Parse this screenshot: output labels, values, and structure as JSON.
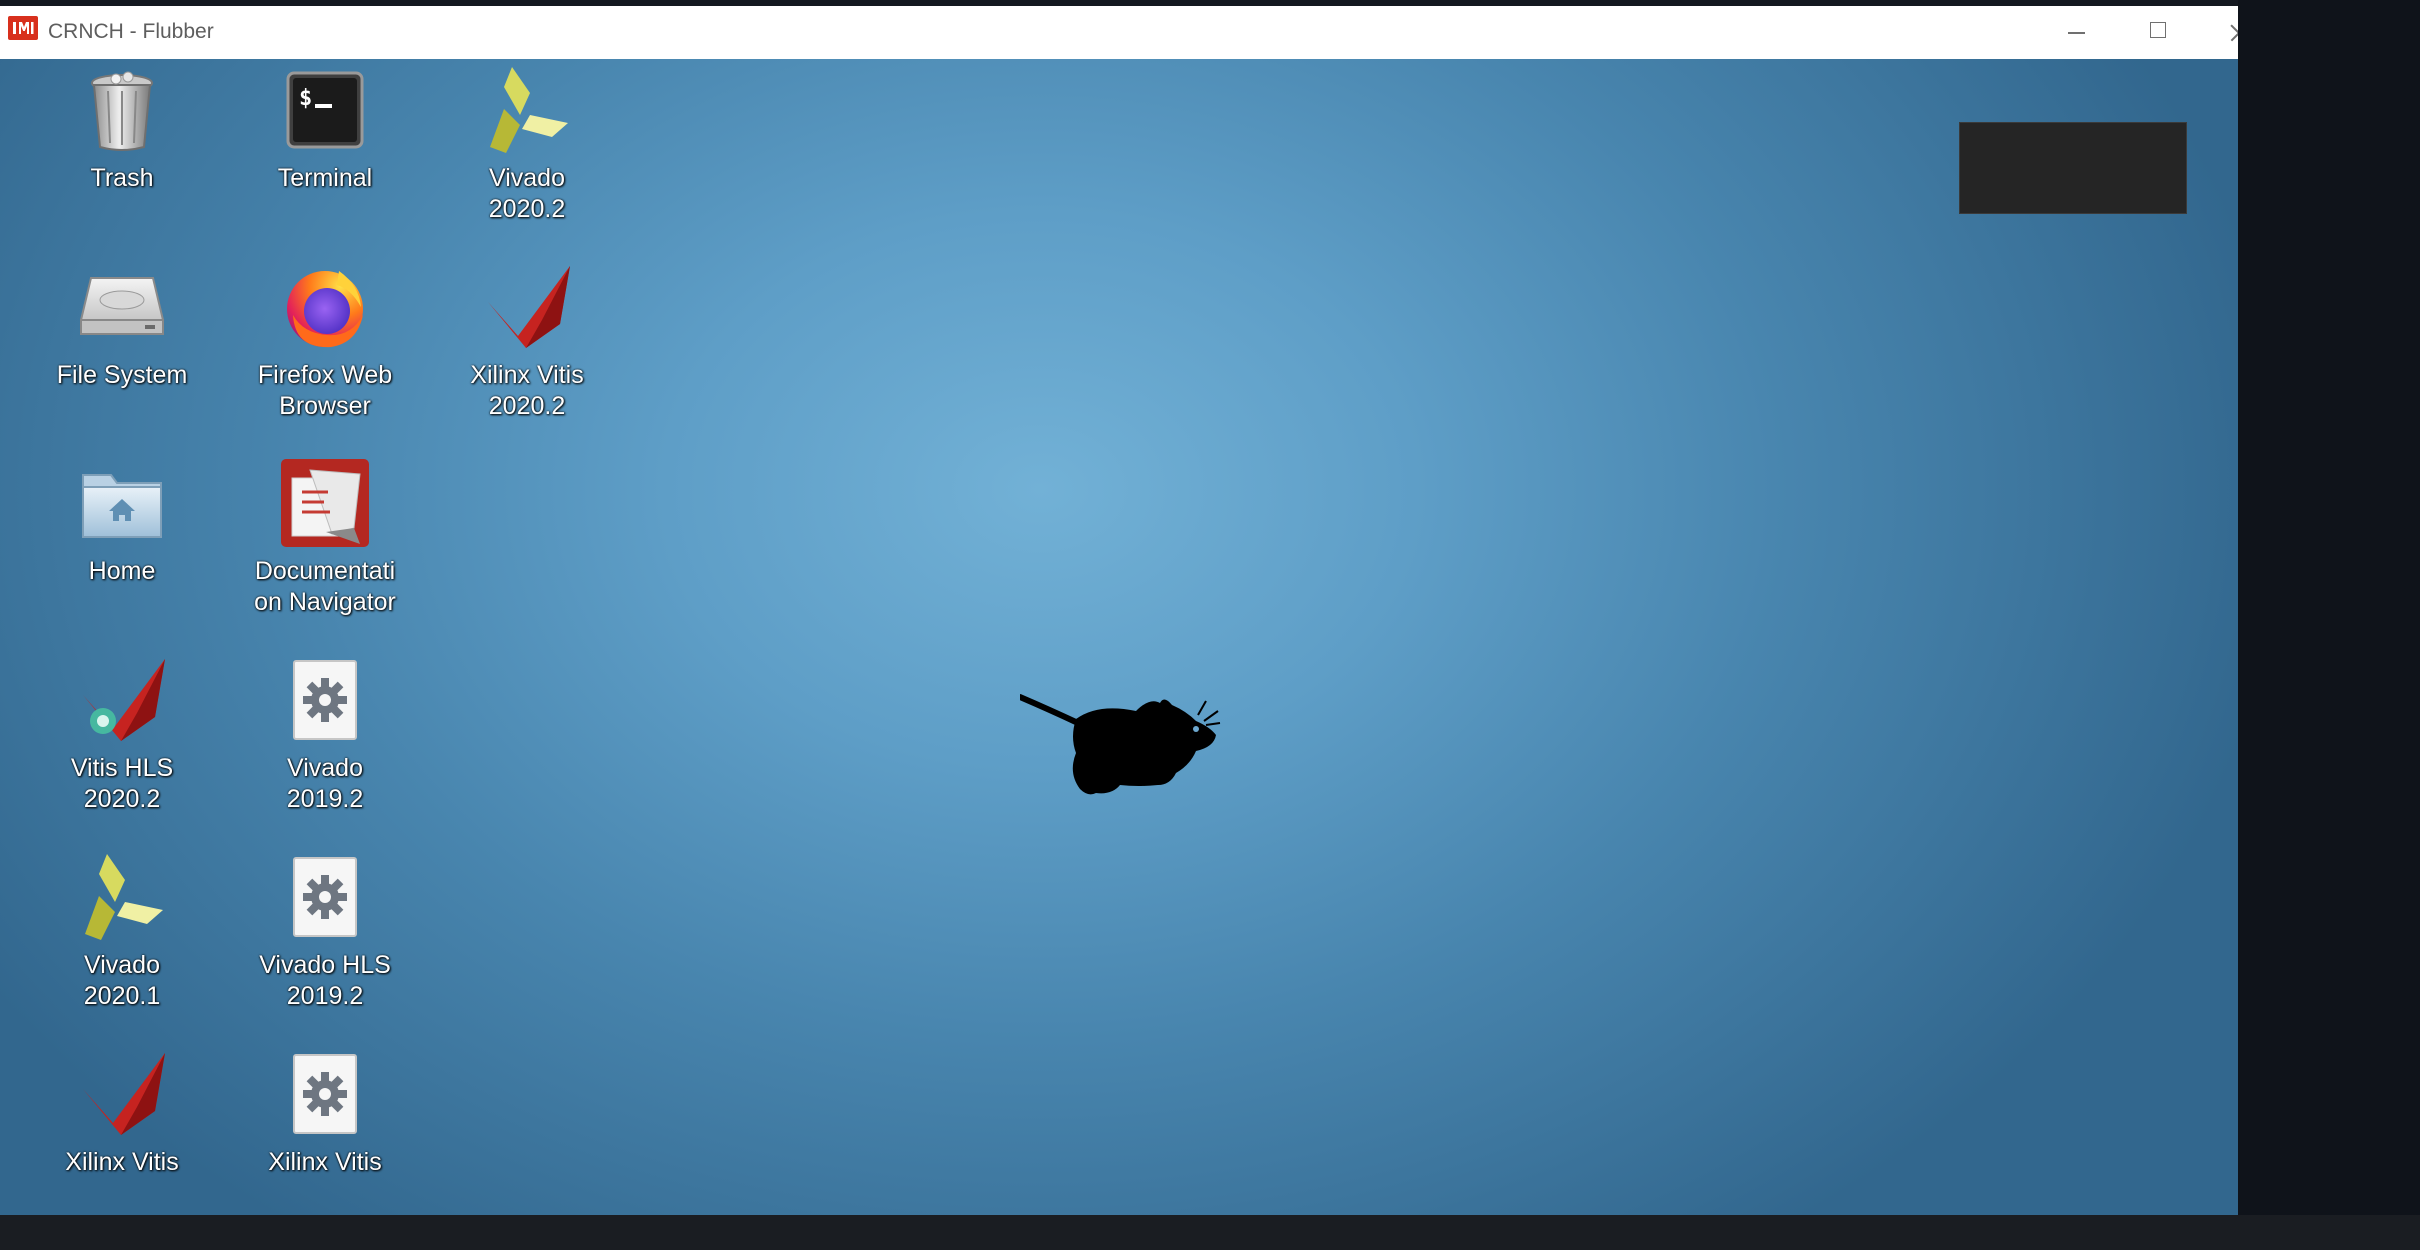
{
  "window": {
    "title": "CRNCH - Flubber",
    "app_icon": "iml-icon",
    "controls": [
      "minimize",
      "maximize",
      "close"
    ]
  },
  "desktop": {
    "background": "xfce-blue-gradient",
    "centerpiece": "xfce-mouse-logo",
    "icons": [
      {
        "id": "trash",
        "label": "Trash",
        "icon": "trash-icon"
      },
      {
        "id": "terminal",
        "label": "Terminal",
        "icon": "terminal-icon"
      },
      {
        "id": "vivado-2020-2",
        "label": "Vivado\n2020.2",
        "icon": "vivado-icon"
      },
      {
        "id": "file-system",
        "label": "File System",
        "icon": "drive-icon"
      },
      {
        "id": "firefox",
        "label": "Firefox Web\nBrowser",
        "icon": "firefox-icon"
      },
      {
        "id": "xilinx-vitis-2020-2",
        "label": "Xilinx Vitis\n2020.2",
        "icon": "vitis-icon"
      },
      {
        "id": "home",
        "label": "Home",
        "icon": "home-folder-icon"
      },
      {
        "id": "doc-navigator",
        "label": "Documentati\non Navigator",
        "icon": "docnav-icon"
      },
      {
        "id": "vitis-hls-2020-2",
        "label": "Vitis HLS\n2020.2",
        "icon": "vitis-hls-icon"
      },
      {
        "id": "vivado-2019-2",
        "label": "Vivado\n2019.2",
        "icon": "gear-icon"
      },
      {
        "id": "vivado-2020-1",
        "label": "Vivado\n2020.1",
        "icon": "vivado-icon"
      },
      {
        "id": "vivado-hls-2019-2",
        "label": "Vivado HLS\n2019.2",
        "icon": "gear-icon"
      },
      {
        "id": "xilinx-vitis-bottom-1",
        "label": "Xilinx Vitis",
        "icon": "vitis-icon"
      },
      {
        "id": "xilinx-vitis-bottom-2",
        "label": "Xilinx Vitis",
        "icon": "gear-icon"
      }
    ]
  },
  "colors": {
    "desktop_center": "#72b1d6",
    "desktop_edge": "#32678e",
    "titlebar": "#ffffff",
    "outer_frame": "#11151c"
  }
}
